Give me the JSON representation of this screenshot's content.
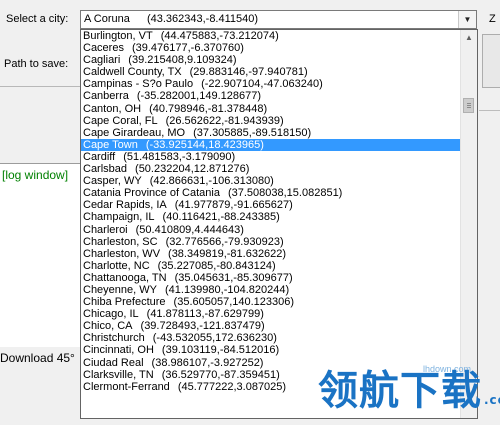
{
  "labels": {
    "select_city": "Select a city:",
    "path_to_save": "Path to save:",
    "z_label": "Z",
    "log_window": "[log window]",
    "download": "Download 45°"
  },
  "combo": {
    "name": "A Coruna",
    "coords": "(43.362343,-8.411540)"
  },
  "cities": [
    {
      "name": "Burlington, VT",
      "coords": "(44.475883,-73.212074)"
    },
    {
      "name": "Caceres",
      "coords": "(39.476177,-6.370760)"
    },
    {
      "name": "Cagliari",
      "coords": "(39.215408,9.109324)"
    },
    {
      "name": "Caldwell County, TX",
      "coords": "(29.883146,-97.940781)"
    },
    {
      "name": "Campinas - S?o Paulo",
      "coords": "(-22.907104,-47.063240)"
    },
    {
      "name": "Canberra",
      "coords": "(-35.282001,149.128677)"
    },
    {
      "name": "Canton, OH",
      "coords": "(40.798946,-81.378448)"
    },
    {
      "name": "Cape Coral, FL",
      "coords": "(26.562622,-81.943939)"
    },
    {
      "name": "Cape Girardeau, MO",
      "coords": "(37.305885,-89.518150)"
    },
    {
      "name": "Cape Town",
      "coords": "(-33.925144,18.423965)"
    },
    {
      "name": "Cardiff",
      "coords": "(51.481583,-3.179090)"
    },
    {
      "name": "Carlsbad",
      "coords": "(50.232204,12.871276)"
    },
    {
      "name": "Casper, WY",
      "coords": "(42.866631,-106.313080)"
    },
    {
      "name": "Catania Province of Catania",
      "coords": "(37.508038,15.082851)"
    },
    {
      "name": "Cedar Rapids, IA",
      "coords": "(41.977879,-91.665627)"
    },
    {
      "name": "Champaign, IL",
      "coords": "(40.116421,-88.243385)"
    },
    {
      "name": "Charleroi",
      "coords": "(50.410809,4.444643)"
    },
    {
      "name": "Charleston, SC",
      "coords": "(32.776566,-79.930923)"
    },
    {
      "name": "Charleston, WV",
      "coords": "(38.349819,-81.632622)"
    },
    {
      "name": "Charlotte, NC",
      "coords": "(35.227085,-80.843124)"
    },
    {
      "name": "Chattanooga, TN",
      "coords": "(35.045631,-85.309677)"
    },
    {
      "name": "Cheyenne, WY",
      "coords": "(41.139980,-104.820244)"
    },
    {
      "name": "Chiba Prefecture",
      "coords": "(35.605057,140.123306)"
    },
    {
      "name": "Chicago, IL",
      "coords": "(41.878113,-87.629799)"
    },
    {
      "name": "Chico, CA",
      "coords": "(39.728493,-121.837479)"
    },
    {
      "name": "Christchurch",
      "coords": "(-43.532055,172.636230)"
    },
    {
      "name": "Cincinnati, OH",
      "coords": "(39.103119,-84.512016)"
    },
    {
      "name": "Ciudad Real",
      "coords": "(38.986107,-3.927252)"
    },
    {
      "name": "Clarksville, TN",
      "coords": "(36.529770,-87.359451)"
    },
    {
      "name": "Clermont-Ferrand",
      "coords": "(45.777222,3.087025)"
    }
  ],
  "selected_index": 9,
  "scrollbar": {
    "up_icon": "▲"
  },
  "combo_arrow_icon": "▼",
  "watermark": {
    "logo": "领航下载",
    "dotcom": ".com",
    "site": "lhdown.com"
  },
  "colors": {
    "selection": "#3399ff",
    "log_text": "#008000",
    "watermark": "#1a73c4"
  }
}
